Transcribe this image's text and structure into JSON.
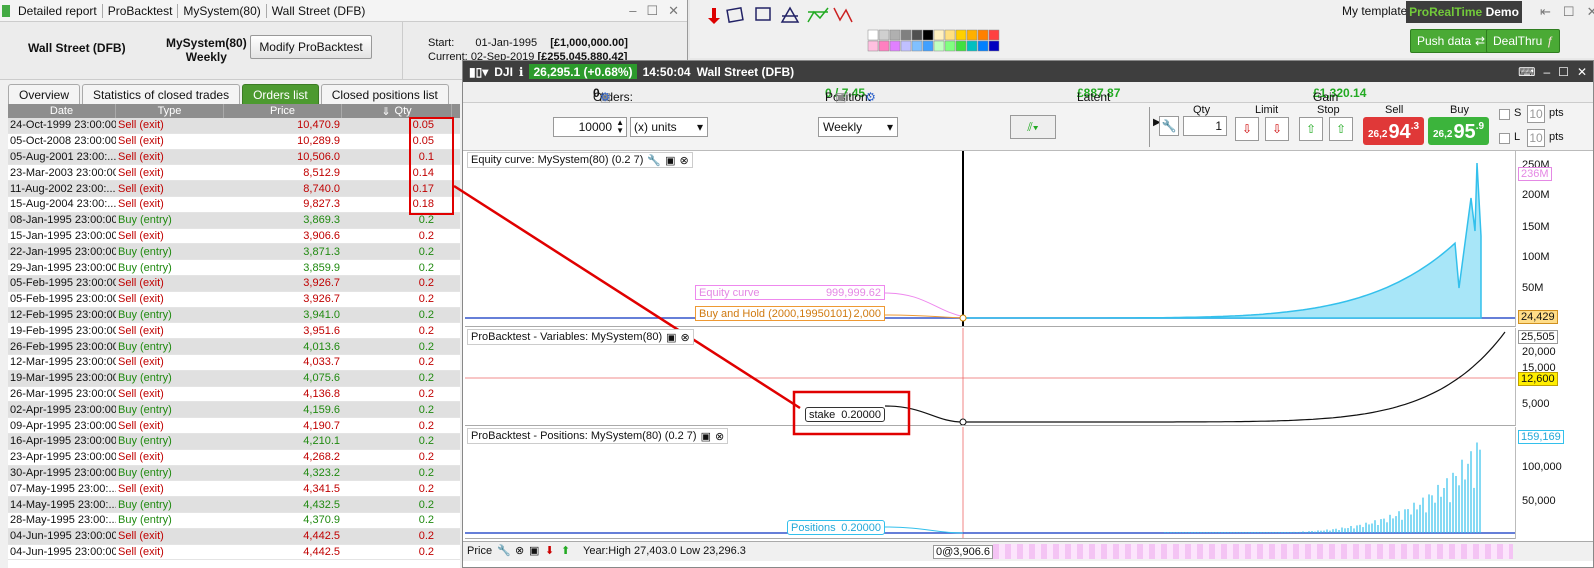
{
  "report": {
    "title_segments": [
      "Detailed report",
      "ProBacktest",
      "MySystem(80)",
      "Wall Street (DFB)"
    ],
    "instrument": "Wall Street (DFB)",
    "system_line1": "MySystem(80)",
    "system_line2": "Weekly",
    "modify_button": "Modify ProBacktest",
    "start_label": "Start:",
    "start_date": "01-Jan-1995",
    "start_capital": "[£1,000,000.00]",
    "current_label": "Current:",
    "current_date": "02-Sep-2019",
    "current_capital": "[£255,045,880.42]",
    "tabs": [
      "Overview",
      "Statistics of closed trades",
      "Orders list",
      "Closed positions list"
    ],
    "active_tab": "Orders list",
    "columns": [
      "Date",
      "Type",
      "Price",
      "Qty"
    ],
    "rows": [
      {
        "date": "24-Oct-1999 23:00:00",
        "type": "Sell (exit)",
        "price": "10,470.9",
        "qty": "0.05"
      },
      {
        "date": "05-Oct-2008 23:00:00",
        "type": "Sell (exit)",
        "price": "10,289.9",
        "qty": "0.05"
      },
      {
        "date": "05-Aug-2001 23:00:...",
        "type": "Sell (exit)",
        "price": "10,506.0",
        "qty": "0.1"
      },
      {
        "date": "23-Mar-2003 23:00:00",
        "type": "Sell (exit)",
        "price": "8,512.9",
        "qty": "0.14"
      },
      {
        "date": "11-Aug-2002 23:00:...",
        "type": "Sell (exit)",
        "price": "8,740.0",
        "qty": "0.17"
      },
      {
        "date": "15-Aug-2004 23:00:...",
        "type": "Sell (exit)",
        "price": "9,827.3",
        "qty": "0.18"
      },
      {
        "date": "08-Jan-1995 23:00:00",
        "type": "Buy (entry)",
        "price": "3,869.3",
        "qty": "0.2"
      },
      {
        "date": "15-Jan-1995 23:00:00",
        "type": "Sell (exit)",
        "price": "3,906.6",
        "qty": "0.2"
      },
      {
        "date": "22-Jan-1995 23:00:00",
        "type": "Buy (entry)",
        "price": "3,871.3",
        "qty": "0.2"
      },
      {
        "date": "29-Jan-1995 23:00:00",
        "type": "Buy (entry)",
        "price": "3,859.9",
        "qty": "0.2"
      },
      {
        "date": "05-Feb-1995 23:00:00",
        "type": "Sell (exit)",
        "price": "3,926.7",
        "qty": "0.2"
      },
      {
        "date": "05-Feb-1995 23:00:00",
        "type": "Sell (exit)",
        "price": "3,926.7",
        "qty": "0.2"
      },
      {
        "date": "12-Feb-1995 23:00:00",
        "type": "Buy (entry)",
        "price": "3,941.0",
        "qty": "0.2"
      },
      {
        "date": "19-Feb-1995 23:00:00",
        "type": "Sell (exit)",
        "price": "3,951.6",
        "qty": "0.2"
      },
      {
        "date": "26-Feb-1995 23:00:00",
        "type": "Buy (entry)",
        "price": "4,013.6",
        "qty": "0.2"
      },
      {
        "date": "12-Mar-1995 23:00:00",
        "type": "Sell (exit)",
        "price": "4,033.7",
        "qty": "0.2"
      },
      {
        "date": "19-Mar-1995 23:00:00",
        "type": "Buy (entry)",
        "price": "4,075.6",
        "qty": "0.2"
      },
      {
        "date": "26-Mar-1995 23:00:00",
        "type": "Sell (exit)",
        "price": "4,136.8",
        "qty": "0.2"
      },
      {
        "date": "02-Apr-1995 23:00:00",
        "type": "Buy (entry)",
        "price": "4,159.6",
        "qty": "0.2"
      },
      {
        "date": "09-Apr-1995 23:00:00",
        "type": "Sell (exit)",
        "price": "4,190.7",
        "qty": "0.2"
      },
      {
        "date": "16-Apr-1995 23:00:00",
        "type": "Buy (entry)",
        "price": "4,210.1",
        "qty": "0.2"
      },
      {
        "date": "23-Apr-1995 23:00:00",
        "type": "Sell (exit)",
        "price": "4,268.2",
        "qty": "0.2"
      },
      {
        "date": "30-Apr-1995 23:00:00",
        "type": "Buy (entry)",
        "price": "4,323.2",
        "qty": "0.2"
      },
      {
        "date": "07-May-1995 23:00:...",
        "type": "Sell (exit)",
        "price": "4,341.5",
        "qty": "0.2"
      },
      {
        "date": "14-May-1995 23:00:...",
        "type": "Buy (entry)",
        "price": "4,432.5",
        "qty": "0.2"
      },
      {
        "date": "28-May-1995 23:00:...",
        "type": "Buy (entry)",
        "price": "4,370.9",
        "qty": "0.2"
      },
      {
        "date": "04-Jun-1995 23:00:00",
        "type": "Sell (exit)",
        "price": "4,442.5",
        "qty": "0.2"
      },
      {
        "date": "04-Jun-1995 23:00:00",
        "type": "Sell (exit)",
        "price": "4,442.5",
        "qty": "0.2"
      }
    ]
  },
  "toolbar": {
    "my_template": "My template",
    "brand_a": "ProRealTime",
    "brand_b": "Demo",
    "push_data": "Push data",
    "dealthru": "DealThru"
  },
  "chart": {
    "symbol": "DJI",
    "price_change": "26,295.1 (+0.68%)",
    "time": "14:50:04",
    "instrument": "Wall Street (DFB)",
    "orders_label": "Orders:",
    "orders_a": "0",
    "orders_b": "/ 0",
    "position_label": "Position:",
    "position_a": "0",
    "position_b": "/ 7.45",
    "latent_label": "Latent gain:",
    "latent_value": "£887.87",
    "gain_label": "Gain today:",
    "gain_value": "£1,320.14",
    "units_value": "10000",
    "units_select": "(x) units",
    "period_select": "Weekly",
    "qty_label": "Qty",
    "qty_value": "1",
    "limit_label": "Limit",
    "stop_label": "Stop",
    "sell_label": "Sell",
    "buy_label": "Buy",
    "sell_small": "26,2",
    "sell_big": "94",
    "sell_sup": ".3",
    "buy_small": "26,2",
    "buy_big": "95",
    "buy_sup": ".9",
    "s_label": "S",
    "l_label": "L",
    "pts_value": "10",
    "pts_label": "pts",
    "pane1_title": "Equity curve: MySystem(80) (0.2 7)",
    "pane2_title": "ProBacktest - Variables: MySystem(80)",
    "pane3_title": "ProBacktest - Positions: MySystem(80) (0.2 7)",
    "legend_equity": "Equity curve",
    "legend_equity_val": "999,999.62",
    "legend_bh": "Buy and Hold (2000,19950101)",
    "legend_bh_val": "2,000",
    "legend_stake": "stake",
    "legend_stake_val": "0.20000",
    "legend_positions": "Positions",
    "legend_positions_val": "0.20000",
    "y1_ticks": [
      "250M",
      "200M",
      "150M",
      "100M",
      "50M"
    ],
    "y1_badge_top": "236M",
    "y1_badge_bottom": "24,429",
    "y2_top": "25,505",
    "y2_ticks": [
      "20,000",
      "15,000",
      "5,000"
    ],
    "y2_badge": "12,600",
    "y3_top": "159,169",
    "y3_ticks": [
      "100,000",
      "50,000"
    ],
    "bottom_price": "Price",
    "bottom_year": "Year:High 27,403.0 Low 23,296.3",
    "bottom_at": "0@3,906.6"
  },
  "colors": {
    "sell": "#c00000",
    "buy": "#208a10",
    "accent_green": "#4aaa35",
    "equity": "#44ccee",
    "annotation_red": "#e00000"
  }
}
